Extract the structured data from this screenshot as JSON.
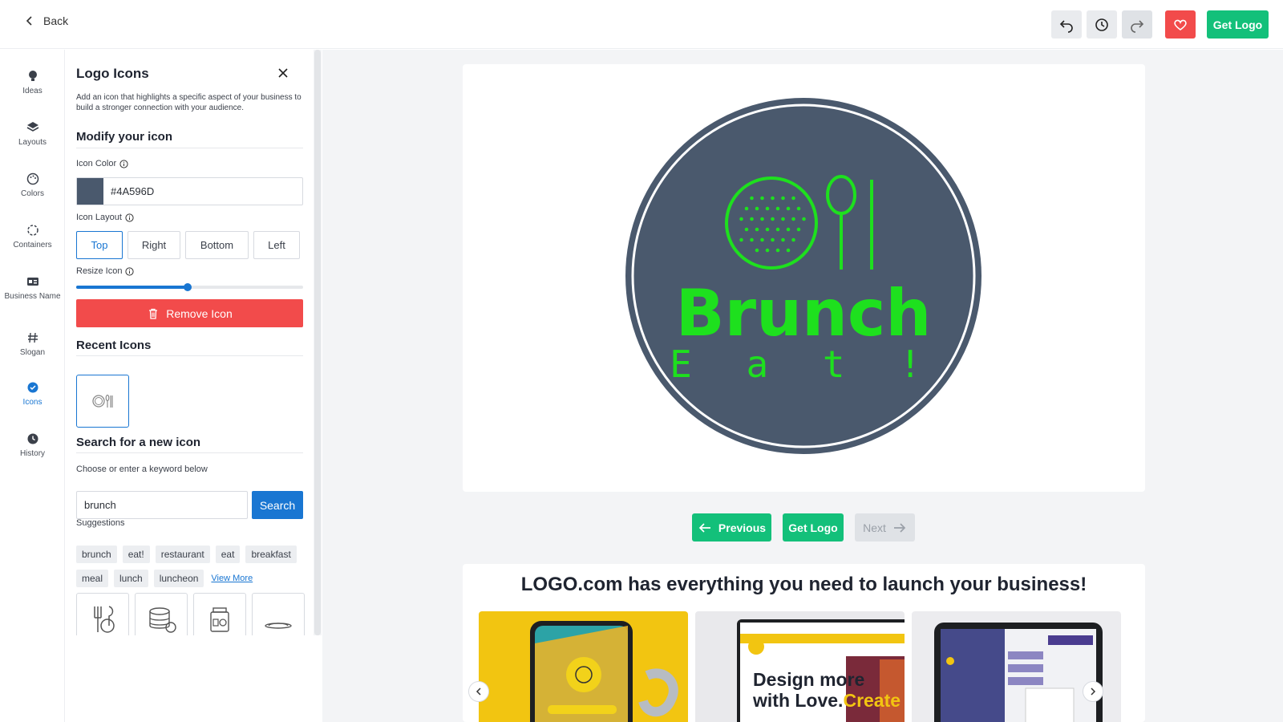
{
  "topbar": {
    "back_label": "Back",
    "get_logo_label": "Get Logo"
  },
  "rail": {
    "items": [
      {
        "label": "Ideas",
        "icon": "lightbulb-icon"
      },
      {
        "label": "Layouts",
        "icon": "layers-icon"
      },
      {
        "label": "Colors",
        "icon": "palette-icon"
      },
      {
        "label": "Containers",
        "icon": "container-icon"
      },
      {
        "label": "Business Name",
        "icon": "id-card-icon"
      },
      {
        "label": "Slogan",
        "icon": "hash-icon"
      },
      {
        "label": "Icons",
        "icon": "check-circle-icon",
        "active": true
      },
      {
        "label": "History",
        "icon": "clock-icon"
      }
    ]
  },
  "panel": {
    "title": "Logo Icons",
    "description": "Add an icon that highlights a specific aspect of your business to build a stronger connection with your audience.",
    "modify_heading": "Modify your icon",
    "icon_color_label": "Icon Color",
    "icon_color_value": "#4A596D",
    "icon_layout_label": "Icon Layout",
    "layout_options": [
      "Top",
      "Right",
      "Bottom",
      "Left"
    ],
    "layout_selected": "Top",
    "resize_label": "Resize Icon",
    "resize_value": 0.49,
    "remove_label": "Remove Icon",
    "recent_heading": "Recent Icons",
    "search_heading": "Search for a new icon",
    "keyword_label": "Choose or enter a keyword below",
    "search_value": "brunch",
    "search_button": "Search",
    "suggestions_label": "Suggestions",
    "suggestions_row1": [
      "brunch",
      "eat!",
      "restaurant",
      "eat",
      "breakfast"
    ],
    "suggestions_row2": [
      "meal",
      "lunch",
      "luncheon"
    ],
    "view_more": "View More"
  },
  "logo": {
    "name": "Brunch",
    "slogan": "E a t !",
    "bg_color": "#4A596D",
    "accent_color": "#1EE01E"
  },
  "nav": {
    "previous": "Previous",
    "get_logo": "Get Logo",
    "next": "Next"
  },
  "promo": {
    "title": "LOGO.com has everything you need to launch your business!",
    "card2_text_line1": "Design more",
    "card2_text_line2": "with Love.",
    "card2_accent": "Create"
  },
  "colors": {
    "primary_green": "#13C07A",
    "primary_blue": "#1976D2",
    "danger_red": "#F24B4B"
  }
}
